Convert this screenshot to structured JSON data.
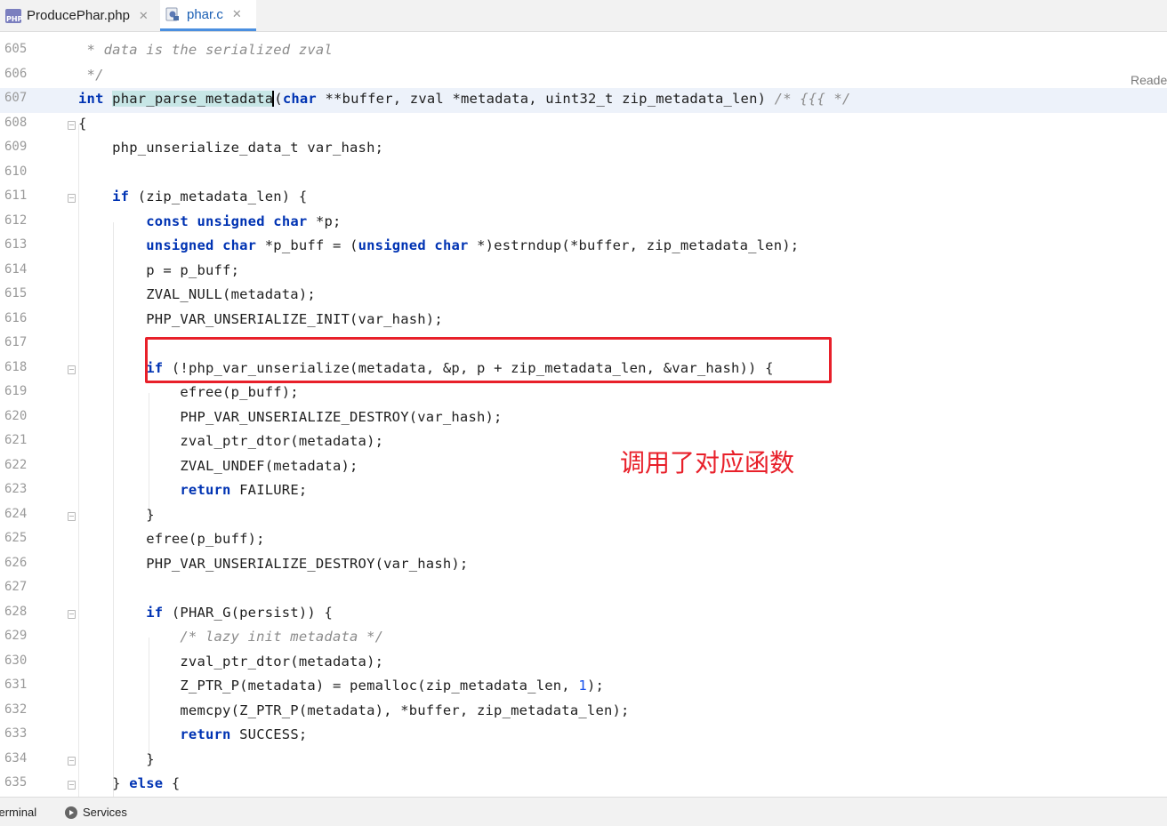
{
  "tabs": [
    {
      "label": "ProducePhar.php",
      "icon": "php-file-icon",
      "icon_text": "PHP",
      "active": false
    },
    {
      "label": "phar.c",
      "icon": "c-file-icon",
      "active": true
    }
  ],
  "reader_mode_label": "Reade",
  "code_lines": [
    {
      "num": "605",
      "text": " * data is the serialized zval"
    },
    {
      "num": "606",
      "text": " */"
    },
    {
      "num": "607",
      "text": "int phar_parse_metadata(char **buffer, zval *metadata, uint32_t zip_metadata_len) /* {{{ */"
    },
    {
      "num": "608",
      "text": "{"
    },
    {
      "num": "609",
      "text": "    php_unserialize_data_t var_hash;"
    },
    {
      "num": "610",
      "text": ""
    },
    {
      "num": "611",
      "text": "    if (zip_metadata_len) {"
    },
    {
      "num": "612",
      "text": "        const unsigned char *p;"
    },
    {
      "num": "613",
      "text": "        unsigned char *p_buff = (unsigned char *)estrndup(*buffer, zip_metadata_len);"
    },
    {
      "num": "614",
      "text": "        p = p_buff;"
    },
    {
      "num": "615",
      "text": "        ZVAL_NULL(metadata);"
    },
    {
      "num": "616",
      "text": "        PHP_VAR_UNSERIALIZE_INIT(var_hash);"
    },
    {
      "num": "617",
      "text": ""
    },
    {
      "num": "618",
      "text": "        if (!php_var_unserialize(metadata, &p, p + zip_metadata_len, &var_hash)) {"
    },
    {
      "num": "619",
      "text": "            efree(p_buff);"
    },
    {
      "num": "620",
      "text": "            PHP_VAR_UNSERIALIZE_DESTROY(var_hash);"
    },
    {
      "num": "621",
      "text": "            zval_ptr_dtor(metadata);"
    },
    {
      "num": "622",
      "text": "            ZVAL_UNDEF(metadata);"
    },
    {
      "num": "623",
      "text": "            return FAILURE;"
    },
    {
      "num": "624",
      "text": "        }"
    },
    {
      "num": "625",
      "text": "        efree(p_buff);"
    },
    {
      "num": "626",
      "text": "        PHP_VAR_UNSERIALIZE_DESTROY(var_hash);"
    },
    {
      "num": "627",
      "text": ""
    },
    {
      "num": "628",
      "text": "        if (PHAR_G(persist)) {"
    },
    {
      "num": "629",
      "text": "            /* lazy init metadata */"
    },
    {
      "num": "630",
      "text": "            zval_ptr_dtor(metadata);"
    },
    {
      "num": "631",
      "text": "            Z_PTR_P(metadata) = pemalloc(zip_metadata_len, 1);"
    },
    {
      "num": "632",
      "text": "            memcpy(Z_PTR_P(metadata), *buffer, zip_metadata_len);"
    },
    {
      "num": "633",
      "text": "            return SUCCESS;"
    },
    {
      "num": "634",
      "text": "        }"
    },
    {
      "num": "635",
      "text": "    } else {"
    }
  ],
  "annotation_text": "调用了对应函数",
  "status_bar": {
    "terminal_label": "Terminal",
    "services_label": "Services"
  },
  "colors": {
    "keyword": "#0033b3",
    "comment": "#8c8c8c",
    "number": "#1750eb",
    "annotation": "#e8202a",
    "current_line": "#edf2fa",
    "identifier_highlight": "#c7e6e6"
  }
}
